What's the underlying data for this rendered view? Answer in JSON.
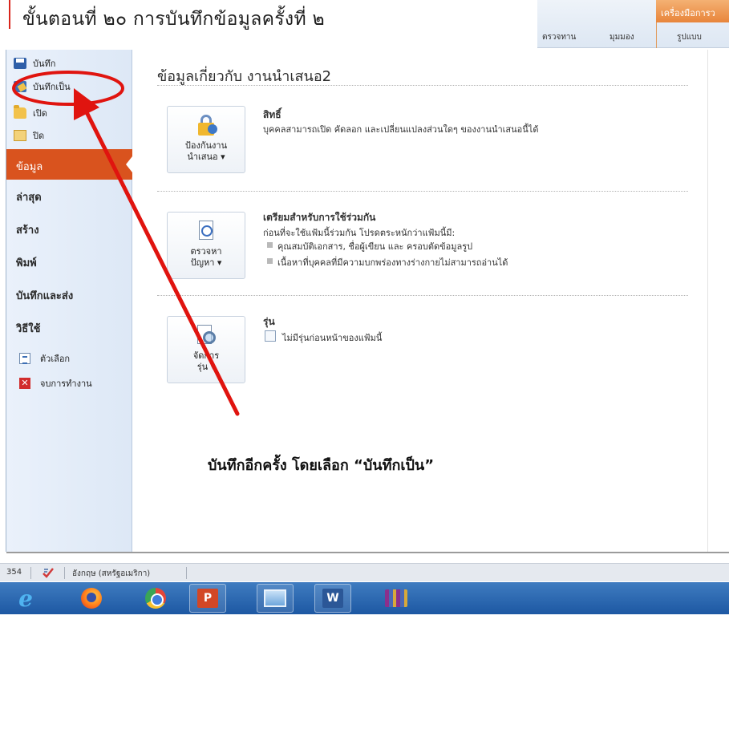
{
  "step_title": "ขั้นตอนที่ ๒๐  การบันทึกข้อมูลครั้งที่ ๒",
  "ribbon": {
    "contextual_tab": "เครื่องมือการว",
    "tabs": [
      "ตรวจทาน",
      "มุมมอง",
      "รูปแบบ"
    ]
  },
  "sidebar": {
    "small_items": [
      {
        "label": "บันทึก",
        "icon": "save-icon"
      },
      {
        "label": "บันทึกเป็น",
        "icon": "save-as-icon"
      },
      {
        "label": "เปิด",
        "icon": "folder-open-icon"
      },
      {
        "label": "ปิด",
        "icon": "folder-close-icon"
      }
    ],
    "active_item": "ข้อมูล",
    "big_items": [
      "ล่าสุด",
      "สร้าง",
      "พิมพ์",
      "บันทึกและส่ง",
      "วิธีใช้"
    ],
    "options": [
      {
        "label": "ตัวเลือก",
        "icon": "options-icon"
      },
      {
        "label": "จบการทำงาน",
        "icon": "exit-icon"
      }
    ]
  },
  "main": {
    "title": "ข้อมูลเกี่ยวกับ งานนำเสนอ2",
    "sections": [
      {
        "button_lines": [
          "ป้องกันงาน",
          "นำเสนอ ▾"
        ],
        "heading": "สิทธิ์",
        "text": "บุคคลสามารถเปิด คัดลอก และเปลี่ยนแปลงส่วนใดๆ ของงานนำเสนอนี้ได้"
      },
      {
        "button_lines": [
          "ตรวจหา",
          "ปัญหา ▾"
        ],
        "heading": "เตรียมสำหรับการใช้ร่วมกัน",
        "text": "ก่อนที่จะใช้แฟ้มนี้ร่วมกัน โปรดตระหนักว่าแฟ้มนี้มี:",
        "bullets": [
          "คุณสมบัติเอกสาร, ชื่อผู้เขียน และ ครอบตัดข้อมูลรูป",
          "เนื้อหาที่บุคคลที่มีความบกพร่องทางร่างกายไม่สามารถอ่านได้"
        ]
      },
      {
        "button_lines": [
          "จัดการ",
          "รุ่น ▾"
        ],
        "heading": "รุ่น",
        "text": "ไม่มีรุ่นก่อนหน้าของแฟ้มนี้"
      }
    ]
  },
  "annotation": "บันทึกอีกครั้ง  โดยเลือก “บันทึกเป็น”",
  "status_bar": {
    "slide_number": "354",
    "language": "อังกฤษ (สหรัฐอเมริกา)"
  },
  "taskbar": {
    "apps": [
      "internet-explorer-icon",
      "firefox-icon",
      "chrome-icon",
      "powerpoint-icon",
      "window-preview-icon",
      "word-icon",
      "winrar-icon"
    ]
  },
  "colors": {
    "annotation_red": "#e0140f",
    "active_orange": "#d9531e",
    "taskbar_blue": "#2a66ad"
  }
}
